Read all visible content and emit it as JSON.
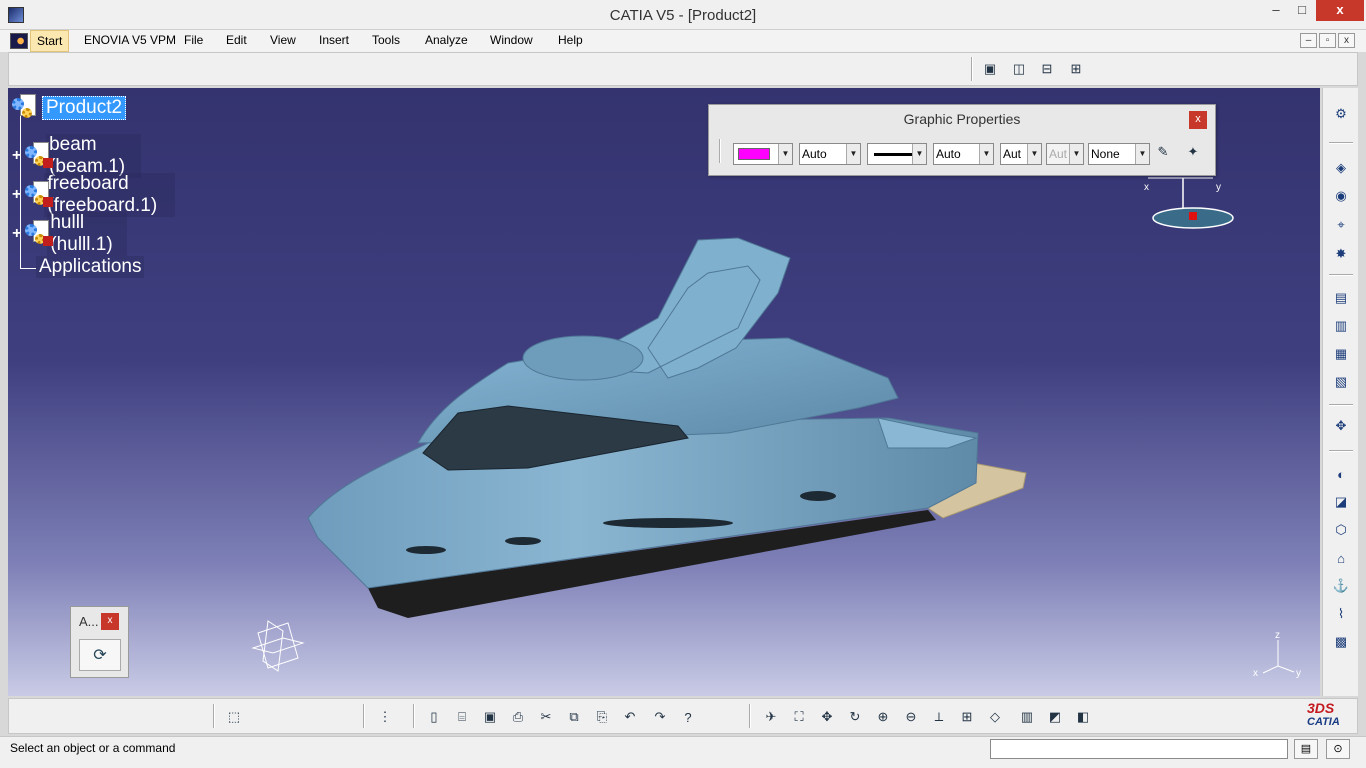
{
  "window": {
    "title": "CATIA V5 - [Product2]",
    "min_glyph": "–",
    "max_glyph": "□",
    "close_glyph": "x"
  },
  "menubar": {
    "items": [
      "Start",
      "ENOVIA V5 VPM",
      "File",
      "Edit",
      "View",
      "Insert",
      "Tools",
      "Analyze",
      "Window",
      "Help"
    ],
    "mdi_buttons": [
      "–",
      "▫",
      "x"
    ]
  },
  "tree": {
    "root": "Product2",
    "children": [
      "beam (beam.1)",
      "freeboard (freeboard.1)",
      "hulll (hulll.1)"
    ],
    "applications": "Applications",
    "expand_glyph": "+"
  },
  "graphic_properties": {
    "title": "Graphic Properties",
    "close": "x",
    "fill_color": "#ff00ff",
    "transparency": "Auto",
    "line_thickness": "Auto",
    "point_symbol": "Aut",
    "layer_disabled": "Aut",
    "layer": "None"
  },
  "mini_toolbar": {
    "title": "A...",
    "close": "x"
  },
  "compass_axes": {
    "x": "x",
    "y": "y"
  },
  "axis_triad": {
    "z": "z",
    "x": "x",
    "y": "y"
  },
  "status": {
    "text": "Select an object or a command",
    "command_value": ""
  },
  "logo": {
    "ds": "3DS",
    "text": "CATIA"
  },
  "colors": {
    "viewport_top": "#34336f",
    "viewport_bottom": "#c9cbe6",
    "hull": "#7aa8c8",
    "bottom_hull": "#1e1e1e",
    "deck": "#d4c4a0",
    "selection": "#3399ff"
  }
}
